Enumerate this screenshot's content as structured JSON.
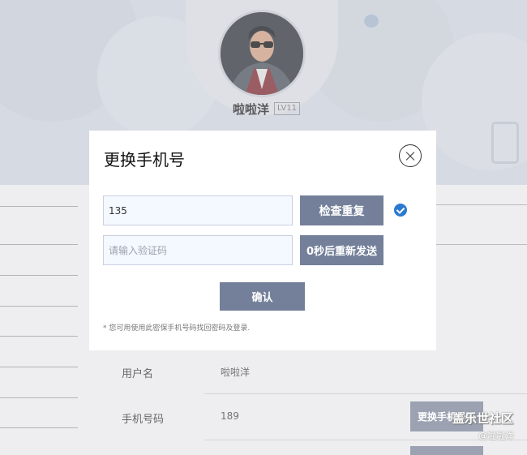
{
  "profile": {
    "username": "啦啦洋",
    "level": "LV11"
  },
  "info_rows": [
    {
      "label": "用户名",
      "value": "啦啦洋"
    },
    {
      "label": "手机号码",
      "value": "189"
    }
  ],
  "buttons": {
    "change_phone": "更换手机号码"
  },
  "modal": {
    "title": "更换手机号",
    "phone_value": "135",
    "code_placeholder": "请输入验证码",
    "check_button": "检查重复",
    "resend_button": "0秒后重新发送",
    "confirm_button": "确认",
    "hint": "* 您可用使用此密保手机号码找回密码及登录."
  },
  "watermark": {
    "main": "盖乐世社区",
    "sub": "@啦啦洋"
  },
  "colors": {
    "button": "#74809a",
    "check_accent": "#2b7ad0"
  }
}
